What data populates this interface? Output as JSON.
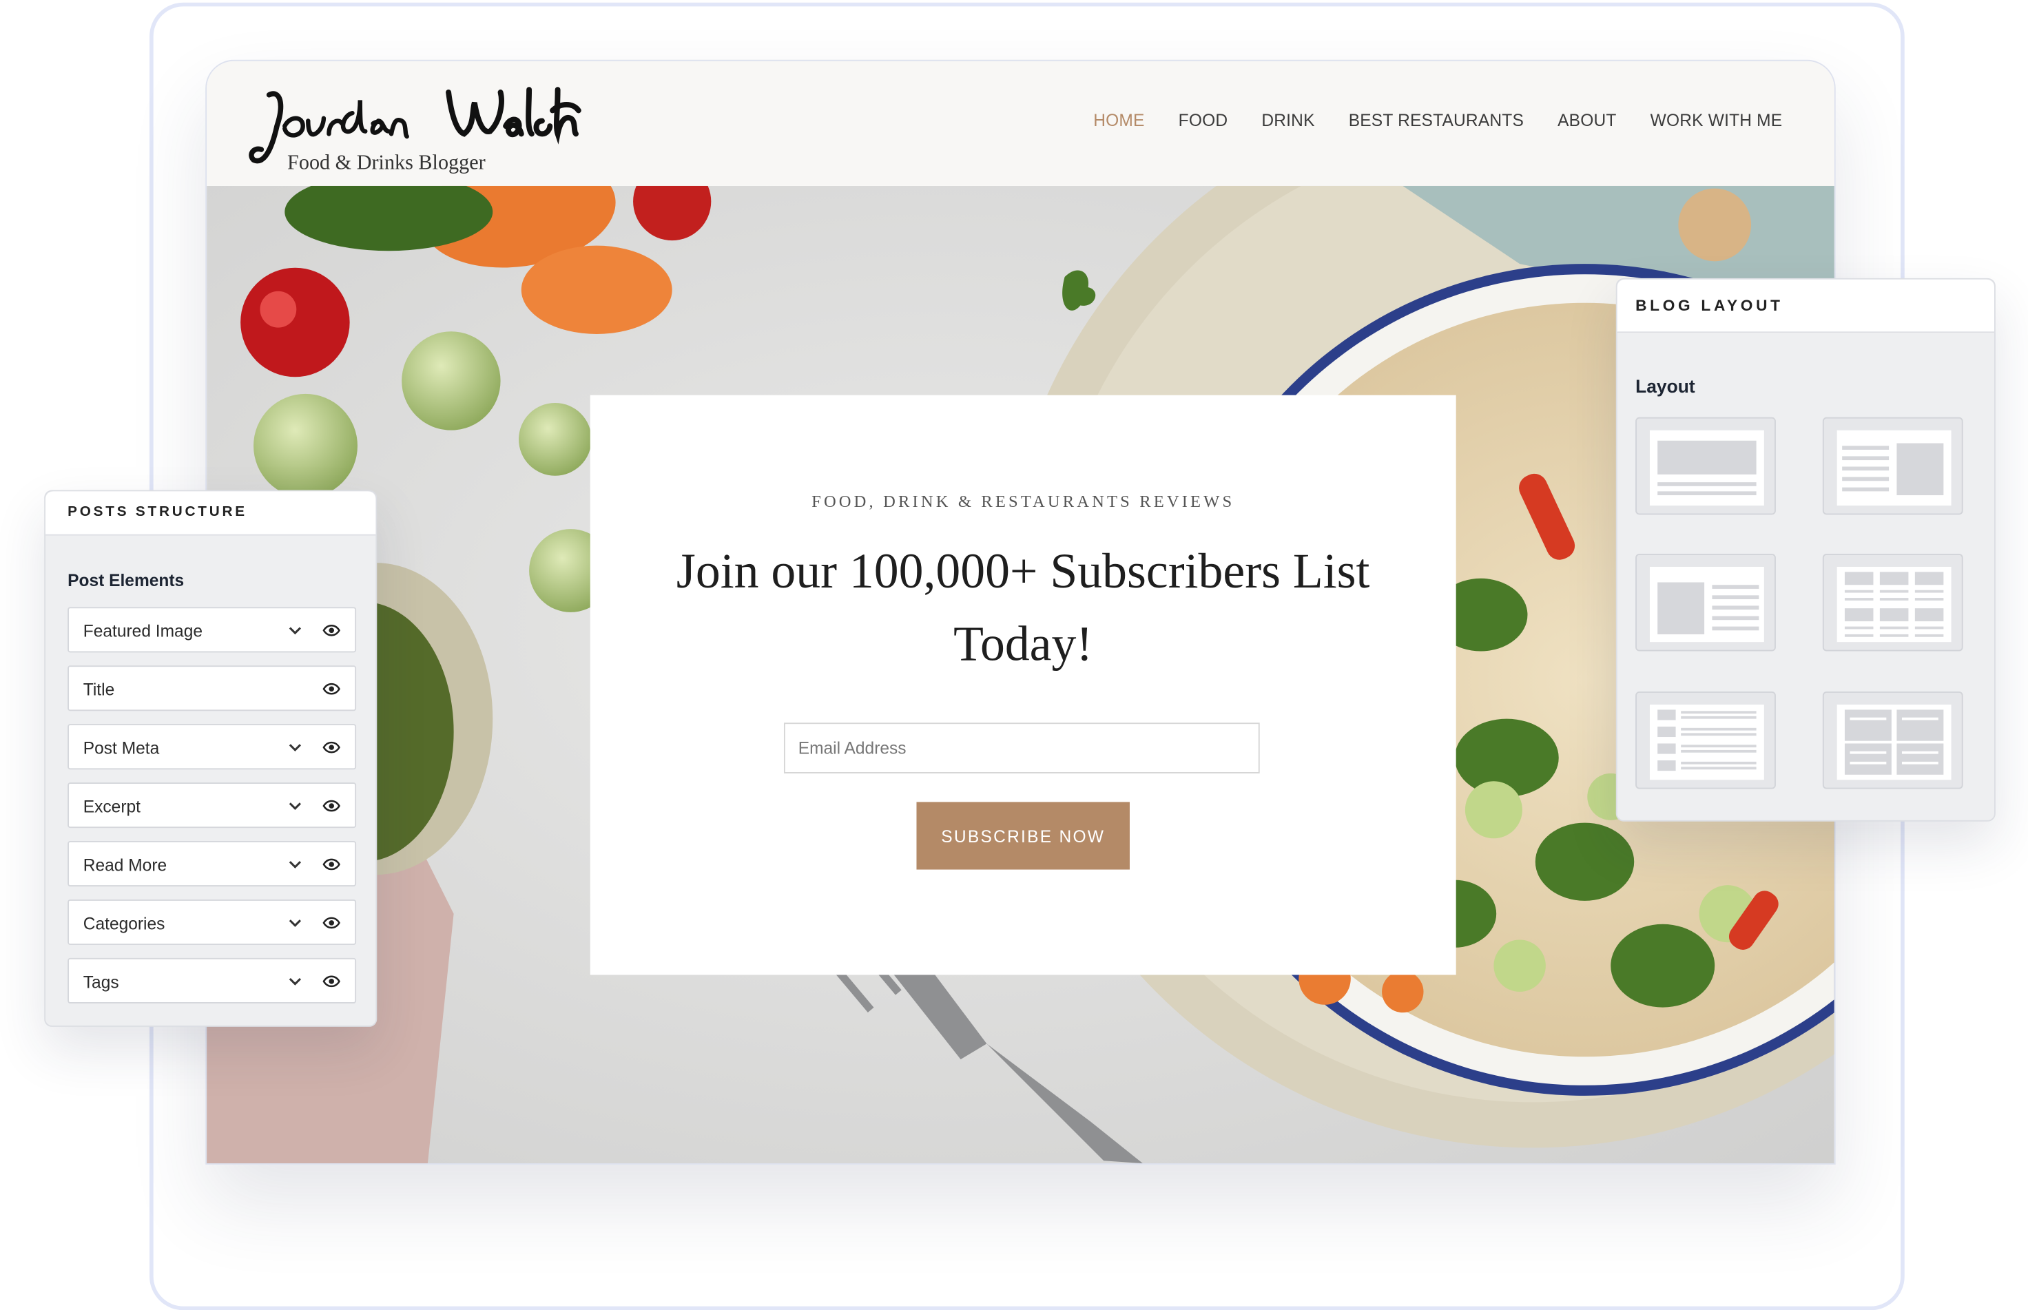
{
  "site": {
    "logo": {
      "name": "Jordan Walsh",
      "tagline": "Food & Drinks Blogger"
    },
    "nav": [
      {
        "label": "HOME",
        "active": true
      },
      {
        "label": "FOOD",
        "active": false
      },
      {
        "label": "DRINK",
        "active": false
      },
      {
        "label": "BEST RESTAURANTS",
        "active": false
      },
      {
        "label": "ABOUT",
        "active": false
      },
      {
        "label": "WORK WITH ME",
        "active": false
      }
    ],
    "accent_color": "#b48a67"
  },
  "hero": {
    "eyebrow": "FOOD, DRINK & RESTAURANTS REVIEWS",
    "headline": "Join our 100,000+ Subscribers List Today!",
    "email_placeholder": "Email Address",
    "button_label": "SUBSCRIBE NOW"
  },
  "posts_structure": {
    "title": "POSTS STRUCTURE",
    "section": "Post Elements",
    "items": [
      {
        "label": "Featured Image",
        "has_dropdown": true,
        "icon": "eye-icon"
      },
      {
        "label": "Title",
        "has_dropdown": false,
        "icon": "eye-icon"
      },
      {
        "label": "Post Meta",
        "has_dropdown": true,
        "icon": "eye-icon"
      },
      {
        "label": "Excerpt",
        "has_dropdown": true,
        "icon": "eye-icon"
      },
      {
        "label": "Read More",
        "has_dropdown": true,
        "icon": "eye-icon"
      },
      {
        "label": "Categories",
        "has_dropdown": true,
        "icon": "eye-icon"
      },
      {
        "label": "Tags",
        "has_dropdown": true,
        "icon": "eye-icon"
      }
    ]
  },
  "blog_layout": {
    "title": "BLOG LAYOUT",
    "section": "Layout",
    "options": [
      "full-width-image-layout",
      "image-right-layout",
      "image-left-layout",
      "grid-layout",
      "list-thumbnails-layout",
      "two-column-layout"
    ]
  }
}
